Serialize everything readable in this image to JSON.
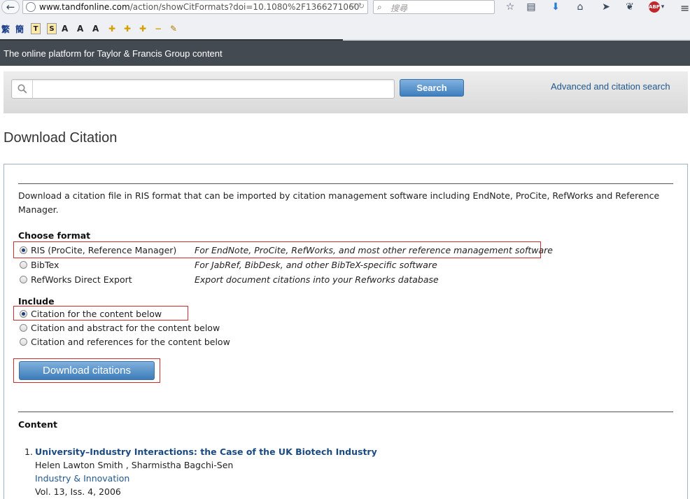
{
  "browser": {
    "url_host": "www.tandfonline.com",
    "url_path": "/action/showCitFormats?doi=10.1080%2F1366271060",
    "search_placeholder": "搜尋",
    "ext_labels": [
      "繁",
      "簡"
    ]
  },
  "header": {
    "tagline": "The online platform for Taylor & Francis Group content"
  },
  "site_search": {
    "value": "",
    "button_label": "Search",
    "advanced_link": "Advanced and citation search"
  },
  "page": {
    "title": "Download Citation"
  },
  "intro": {
    "text": "Download a citation file in RIS format that can be imported by citation management software including EndNote, ProCite, RefWorks and Reference Manager."
  },
  "format": {
    "heading": "Choose format",
    "options": [
      {
        "label": "RIS (ProCite, Reference Manager)",
        "description": "For EndNote, ProCite, RefWorks, and most other reference management software",
        "selected": true
      },
      {
        "label": "BibTex",
        "description": "For JabRef, BibDesk, and other BibTeX-specific software",
        "selected": false
      },
      {
        "label": "RefWorks Direct Export",
        "description": "Export document citations into your Refworks database",
        "selected": false
      }
    ]
  },
  "include": {
    "heading": "Include",
    "options": [
      {
        "label": "Citation for the content below",
        "selected": true
      },
      {
        "label": "Citation and abstract for the content below",
        "selected": false
      },
      {
        "label": "Citation and references for the content below",
        "selected": false
      }
    ]
  },
  "download_button": "Download citations",
  "content": {
    "heading": "Content",
    "items": [
      {
        "number": "1.",
        "title": "University–Industry Interactions: the Case of the UK Biotech Industry",
        "authors": "Helen Lawton Smith , Sharmistha Bagchi-Sen",
        "journal": "Industry & Innovation",
        "volume": "Vol. 13, Iss. 4, 2006"
      }
    ]
  },
  "colors": {
    "header_bg": "#434a52",
    "link": "#21578c",
    "button": "#3d7cb9",
    "highlight_box": "#d62b2b"
  }
}
